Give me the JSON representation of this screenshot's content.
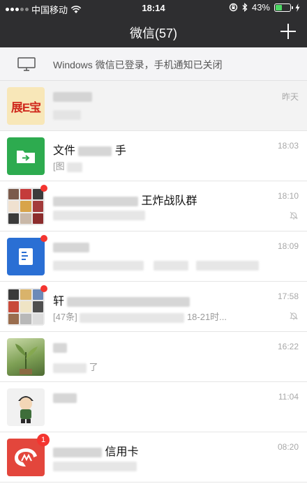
{
  "status_bar": {
    "carrier": "中国移动",
    "time": "18:14",
    "battery_percent": "43%",
    "battery_level": 0.43
  },
  "nav": {
    "title": "微信(57)",
    "add_icon": "plus-icon"
  },
  "notice": {
    "icon": "monitor-icon",
    "text": "Windows 微信已登录，手机通知已关闭"
  },
  "chats": [
    {
      "avatar_text": "展E宝",
      "title_visible": "",
      "time": "昨天",
      "pinned": true
    },
    {
      "title_visible": "文件",
      "title_tail": "手",
      "preview_visible": "[图",
      "time": "18:03"
    },
    {
      "title_visible": "王炸战队群",
      "time": "18:10",
      "muted": true,
      "badge": "dot"
    },
    {
      "title_visible": "",
      "time": "18:09",
      "badge": "dot"
    },
    {
      "title_visible": "轩",
      "preview_visible": "[47条]",
      "preview_tail": "18-21时...",
      "time": "17:58",
      "muted": true,
      "badge": "dot"
    },
    {
      "title_visible": "",
      "preview_tail": "了",
      "time": "16:22"
    },
    {
      "title_visible": "",
      "time": "11:04"
    },
    {
      "title_visible": "信用卡",
      "time": "08:20",
      "badge": "1"
    }
  ],
  "colors": {
    "header_bg": "#2e2e30",
    "accent_green": "#2dab4f",
    "badge_red": "#f43530"
  }
}
